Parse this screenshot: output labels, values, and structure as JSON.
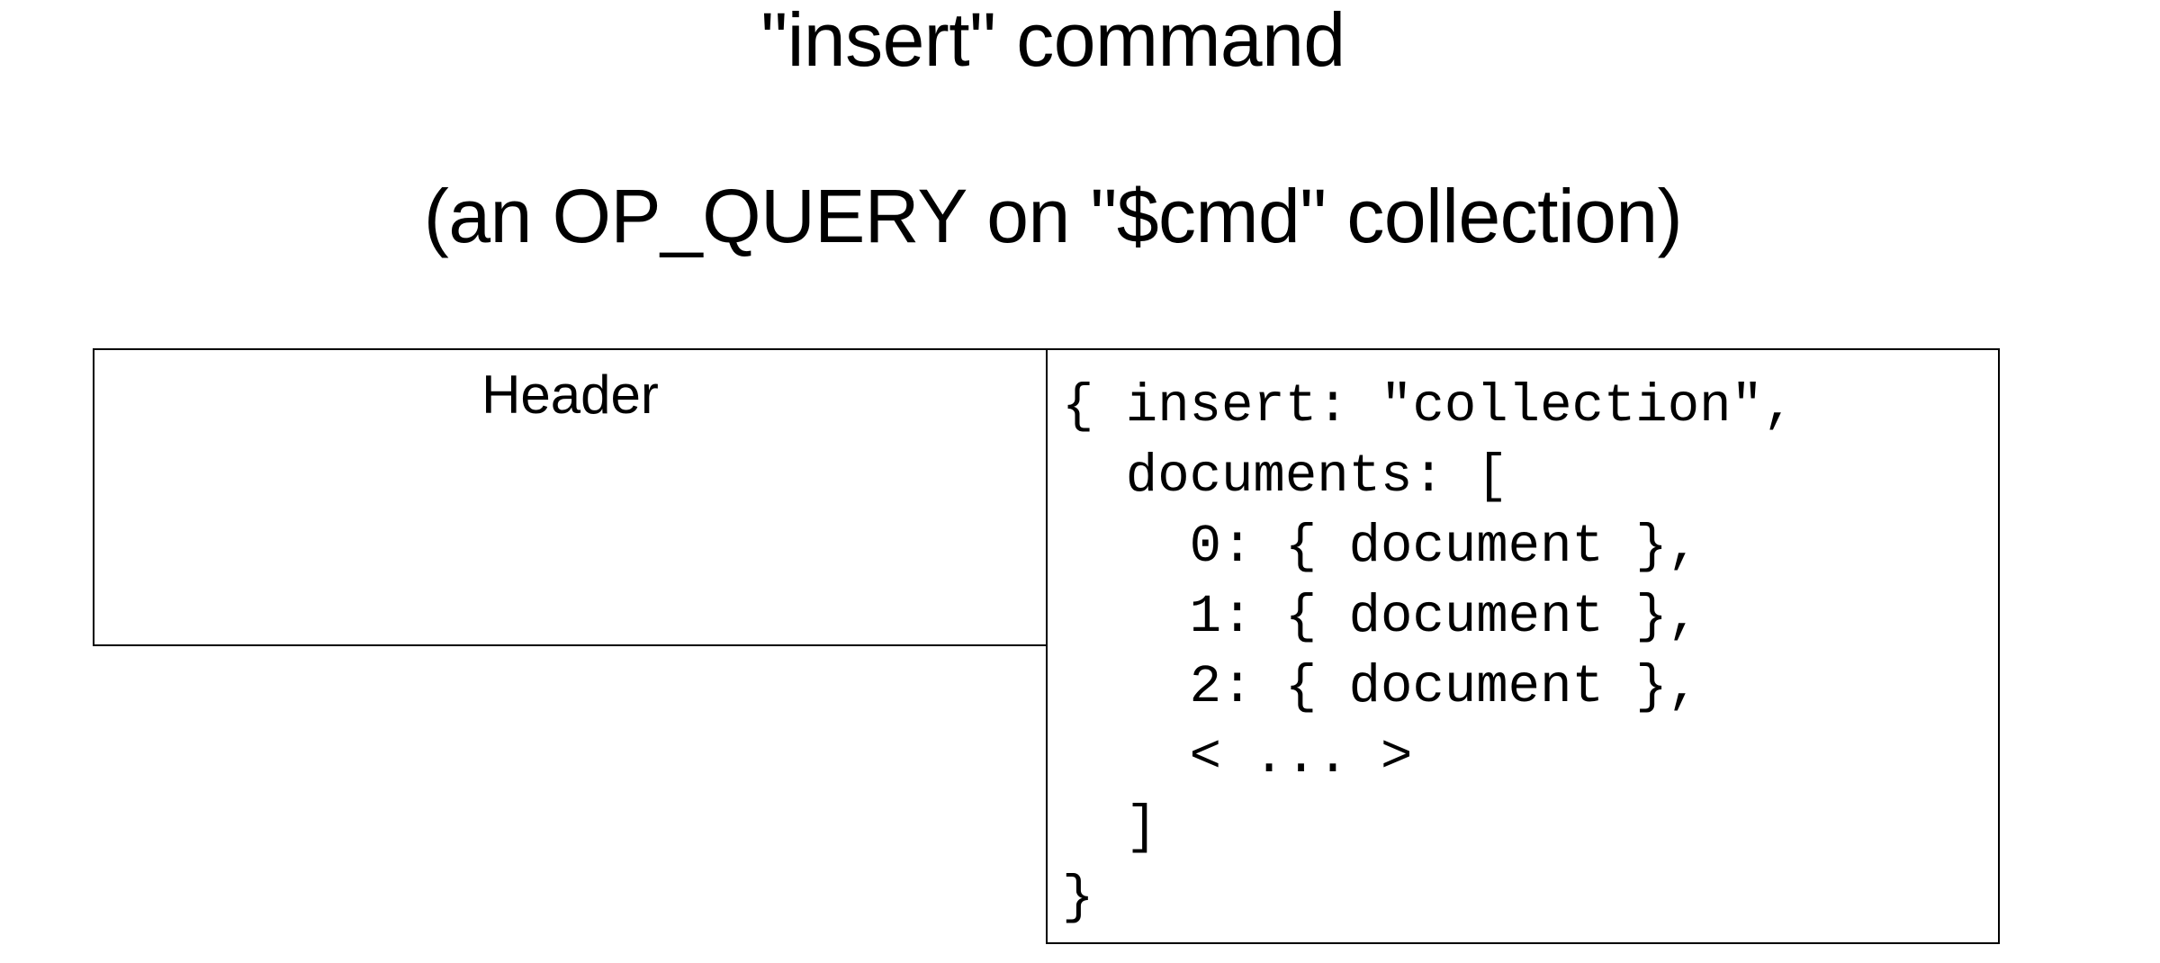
{
  "title": {
    "line1": "\"insert\" command",
    "line2": "(an OP_QUERY on \"$cmd\" collection)"
  },
  "header_box": {
    "label": "Header"
  },
  "body_box": {
    "lines": [
      "{ insert: \"collection\",",
      "  documents: [",
      "    0: { document },",
      "    1: { document },",
      "    2: { document },",
      "    < ... >",
      "  ]",
      "}"
    ]
  }
}
